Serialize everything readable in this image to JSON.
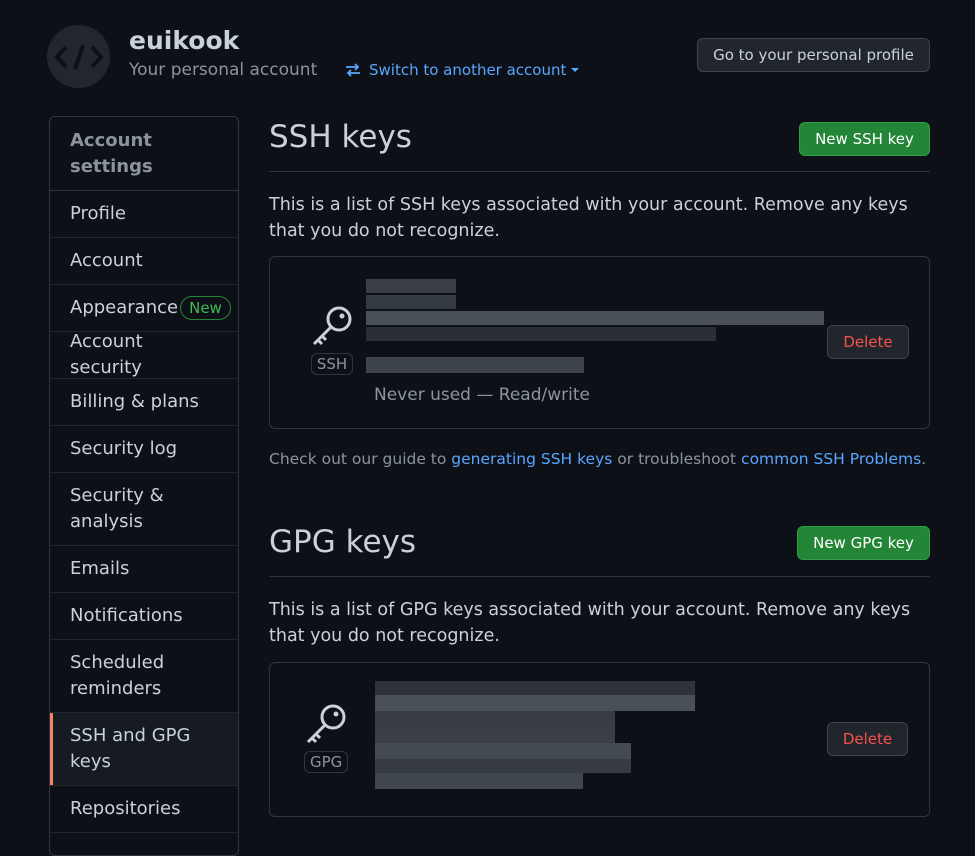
{
  "header": {
    "username": "euikook",
    "subtitle": "Your personal account",
    "switch_label": "Switch to another account",
    "profile_button": "Go to your personal profile"
  },
  "sidebar": {
    "heading": "Account settings",
    "items": [
      {
        "label": "Profile"
      },
      {
        "label": "Account"
      },
      {
        "label": "Appearance",
        "badge": "New"
      },
      {
        "label": "Account security"
      },
      {
        "label": "Billing & plans"
      },
      {
        "label": "Security log"
      },
      {
        "label": "Security & analysis"
      },
      {
        "label": "Emails"
      },
      {
        "label": "Notifications"
      },
      {
        "label": "Scheduled reminders"
      },
      {
        "label": "SSH and GPG keys",
        "active": true
      },
      {
        "label": "Repositories"
      }
    ]
  },
  "ssh": {
    "title": "SSH keys",
    "new_button": "New SSH key",
    "description": "This is a list of SSH keys associated with your account. Remove any keys that you do not recognize.",
    "key": {
      "type": "SSH",
      "usage": "Never used — Read/write",
      "delete": "Delete"
    },
    "guide": {
      "prefix": "Check out our guide to ",
      "link1": "generating SSH keys",
      "middle": " or troubleshoot ",
      "link2": "common SSH Problems",
      "suffix": "."
    }
  },
  "gpg": {
    "title": "GPG keys",
    "new_button": "New GPG key",
    "description": "This is a list of GPG keys associated with your account. Remove any keys that you do not recognize.",
    "key": {
      "type": "GPG",
      "delete": "Delete"
    }
  },
  "colors": {
    "background": "#0d1117",
    "accent_link": "#58a6ff",
    "primary_button": "#238636",
    "danger": "#f85149",
    "active_marker": "#f78166"
  }
}
